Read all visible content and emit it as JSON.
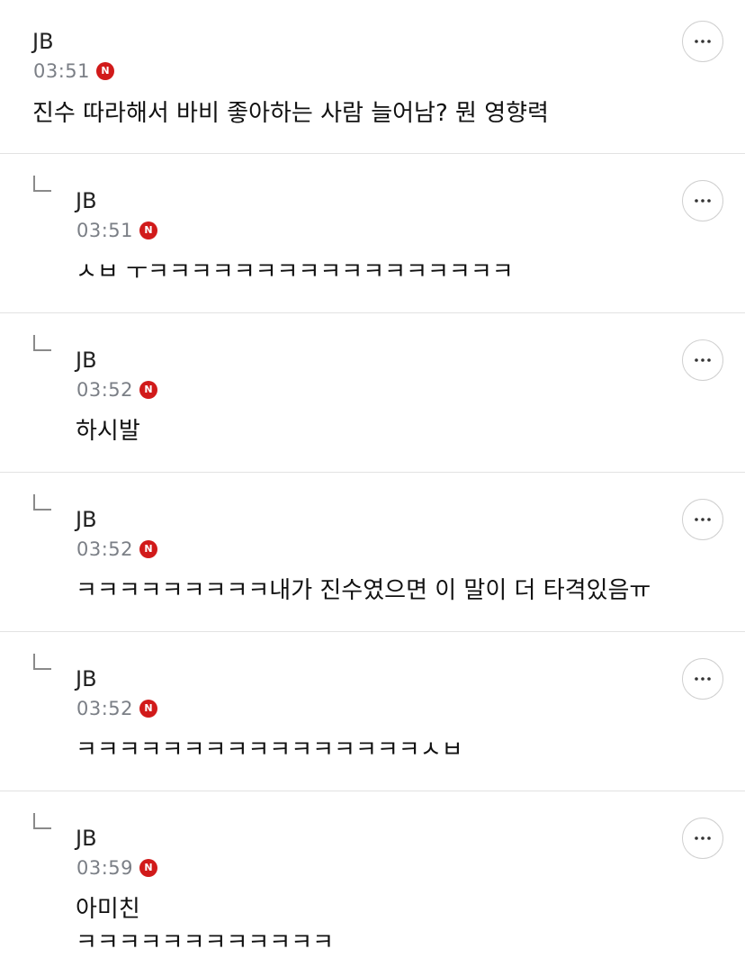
{
  "comments": [
    {
      "author": "JB",
      "time": "03:51",
      "badge": "N",
      "text": "진수 따라해서 바비 좋아하는 사람 늘어남? 뭔 영향력"
    },
    {
      "author": "JB",
      "time": "03:51",
      "badge": "N",
      "text": "ㅅㅂ ㅜㅋㅋㅋㅋㅋㅋㅋㅋㅋㅋㅋㅋㅋㅋㅋㅋㅋ"
    },
    {
      "author": "JB",
      "time": "03:52",
      "badge": "N",
      "text": "하시발"
    },
    {
      "author": "JB",
      "time": "03:52",
      "badge": "N",
      "text": "ㅋㅋㅋㅋㅋㅋㅋㅋㅋ내가 진수였으면 이 말이 더 타격있음ㅠ"
    },
    {
      "author": "JB",
      "time": "03:52",
      "badge": "N",
      "text": "ㅋㅋㅋㅋㅋㅋㅋㅋㅋㅋㅋㅋㅋㅋㅋㅋㅅㅂ"
    },
    {
      "author": "JB",
      "time": "03:59",
      "badge": "N",
      "text": "아미친",
      "text2": "ㅋㅋㅋㅋㅋㅋㅋㅋㅋㅋㅋㅋ"
    }
  ],
  "colors": {
    "badge": "#d11a1a",
    "meta_text": "#7b7f86",
    "divider": "#e2e2e2"
  },
  "icons": {
    "more": "more-horizontal-icon",
    "reply": "reply-indicator-icon",
    "badge": "new-badge-icon"
  }
}
